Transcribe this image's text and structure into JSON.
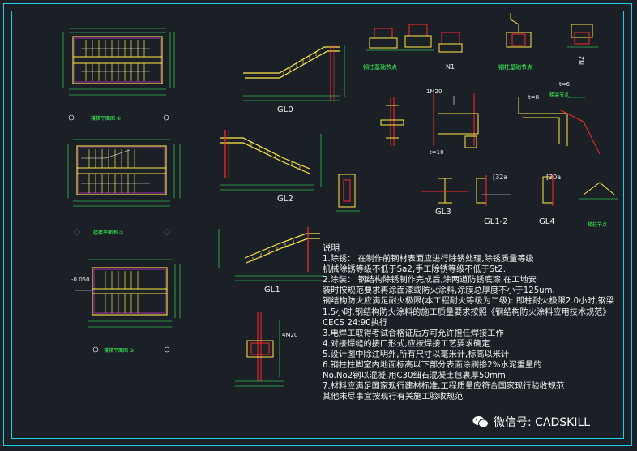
{
  "drawing": {
    "titles": {
      "plan1": "楼梯平面图 ①",
      "plan2": "楼梯平面图 ②",
      "plan3": "楼梯平面图 ③",
      "gl0": "GL0",
      "gl2": "GL2",
      "gl1": "GL1",
      "gl3": "GL3",
      "gl12": "GL1-2",
      "gl4": "GL4",
      "base_a": "钢柱基础节点",
      "base_b": "钢柱基础节点",
      "n1": "N1",
      "n2": "N2",
      "mid_detail": "梯梁节点",
      "bottom_detail": "梯柱节点"
    },
    "callouts": {
      "m20": "1M20",
      "t6": "t=6",
      "t10": "t=10",
      "t8": "t=8",
      "c32": "[32a",
      "c20": "[20a",
      "m20b": "4M20",
      "elev": "-0.050"
    },
    "notes": {
      "heading": "说明",
      "lines": [
        "1.除锈：  在制作前钢材表面应进行除锈处理,除锈质量等级",
        "  机械除锈等级不低于Sa2,手工除锈等级不低于St2.",
        "2.涂装：  钢结构除锈制作完成后,涂两道防锈底漆,在工地安",
        "  装时按规范要求再涂面漆或防火涂料,涂膜总厚度不小于125um.",
        "钢结构防火应满足耐火极限(本工程耐火等级为二级):   即柱耐火极限2.0小时,钢梁",
        "      1.5小时.钢结构防火涂料的施工质量要求按照《钢结构防火涂料应用技术规范》",
        "      CECS 24:90执行",
        "3.电焊工取得考试合格证后方可允许担任焊接工作",
        "4.对接焊缝的接口形式,应按焊接工艺要求确定",
        "5.设计图中除注明外,所有尺寸以毫米计,标高以米计",
        "6.钢柱柱脚室内地面标高以下部分表面涂刷掺2%水泥重量的",
        "  No.No2钢以混凝,用C30细石混凝土包裹厚50mm",
        "7.材料应满足国家现行建材标准,工程质量应符合国家现行验收规范",
        "  其他未尽事宜按现行有关施工验收规范"
      ]
    },
    "watermark": "微信号: CADSKILL",
    "colors": {
      "frame": "#19d1e6",
      "stair": "#ffe94a",
      "steel": "#ff2a2a",
      "text_green": "#3dff5a",
      "text_white": "#f2f2f2",
      "dim_green": "#3dff5a",
      "magenta": "#ff3bff",
      "background": "#1b2027"
    }
  }
}
